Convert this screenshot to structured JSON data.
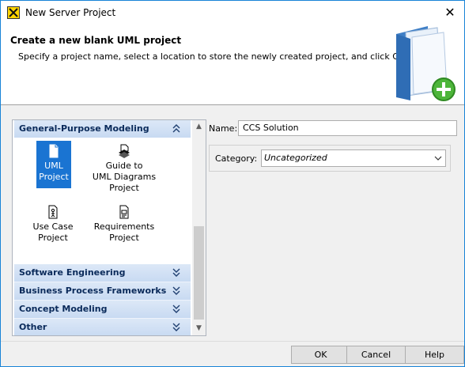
{
  "window": {
    "title": "New Server Project",
    "close_symbol": "✕"
  },
  "header": {
    "title": "Create a new blank UML project",
    "subtitle": "Specify a project name, select a location to store the newly created project, and click OK."
  },
  "groups": [
    {
      "label": "General-Purpose Modeling",
      "expanded": true
    },
    {
      "label": "Software Engineering",
      "expanded": false
    },
    {
      "label": "Business Process Frameworks",
      "expanded": false
    },
    {
      "label": "Concept Modeling",
      "expanded": false
    },
    {
      "label": "Other",
      "expanded": false
    }
  ],
  "project_types": [
    {
      "label": "UML\nProject",
      "icon": "document-icon",
      "selected": true
    },
    {
      "label": "Guide to\nUML Diagrams\nProject",
      "icon": "guide-icon",
      "selected": false
    },
    {
      "label": "Use Case\nProject",
      "icon": "use-case-icon",
      "selected": false
    },
    {
      "label": "Requirements\nProject",
      "icon": "requirements-icon",
      "selected": false
    }
  ],
  "form": {
    "name_label": "Name:",
    "name_value": "CCS Solution",
    "category_label": "Category:",
    "category_value": "Uncategorized"
  },
  "buttons": {
    "ok": "OK",
    "cancel": "Cancel",
    "help": "Help"
  },
  "colors": {
    "accent": "#1a74d2",
    "group_header": "#c8daf2",
    "window_border": "#1883d7"
  }
}
